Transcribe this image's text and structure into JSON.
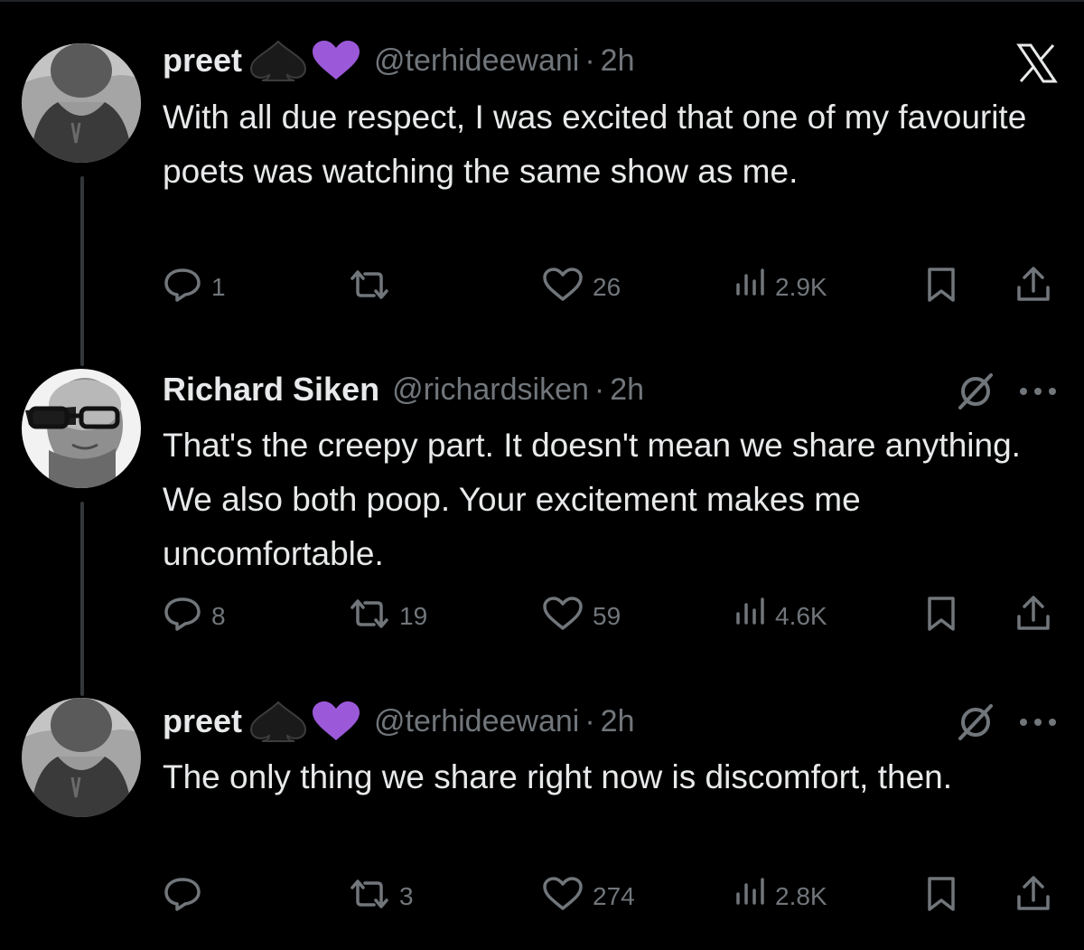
{
  "colors": {
    "background": "#000000",
    "primary_text": "#e7e9ea",
    "secondary_text": "#71767b",
    "heart_emoji": "#9b59d9",
    "thread_line": "#333639"
  },
  "tweets": [
    {
      "name": "preet",
      "emojis": [
        "black-spade-emoji",
        "purple-heart-emoji"
      ],
      "handle": "@terhideewani",
      "separator": "·",
      "time": "2h",
      "text": "With all due respect, I was excited that one of my favourite poets was watching the same show as me.",
      "replies": "1",
      "reposts": "",
      "likes": "26",
      "views": "2.9K",
      "corner_icon": "x-logo-icon"
    },
    {
      "name": "Richard Siken",
      "emojis": [],
      "handle": "@richardsiken",
      "separator": "·",
      "time": "2h",
      "text": "That's the creepy part. It doesn't mean we share anything. We also both poop. Your excitement makes me uncomfortable.",
      "replies": "8",
      "reposts": "19",
      "likes": "59",
      "views": "4.6K",
      "corner_icon": "grok-icon"
    },
    {
      "name": "preet",
      "emojis": [
        "black-spade-emoji",
        "purple-heart-emoji"
      ],
      "handle": "@terhideewani",
      "separator": "·",
      "time": "2h",
      "text": "The only thing we share right now is discomfort, then.",
      "replies": "",
      "reposts": "3",
      "likes": "274",
      "views": "2.8K",
      "corner_icon": "grok-icon"
    }
  ]
}
